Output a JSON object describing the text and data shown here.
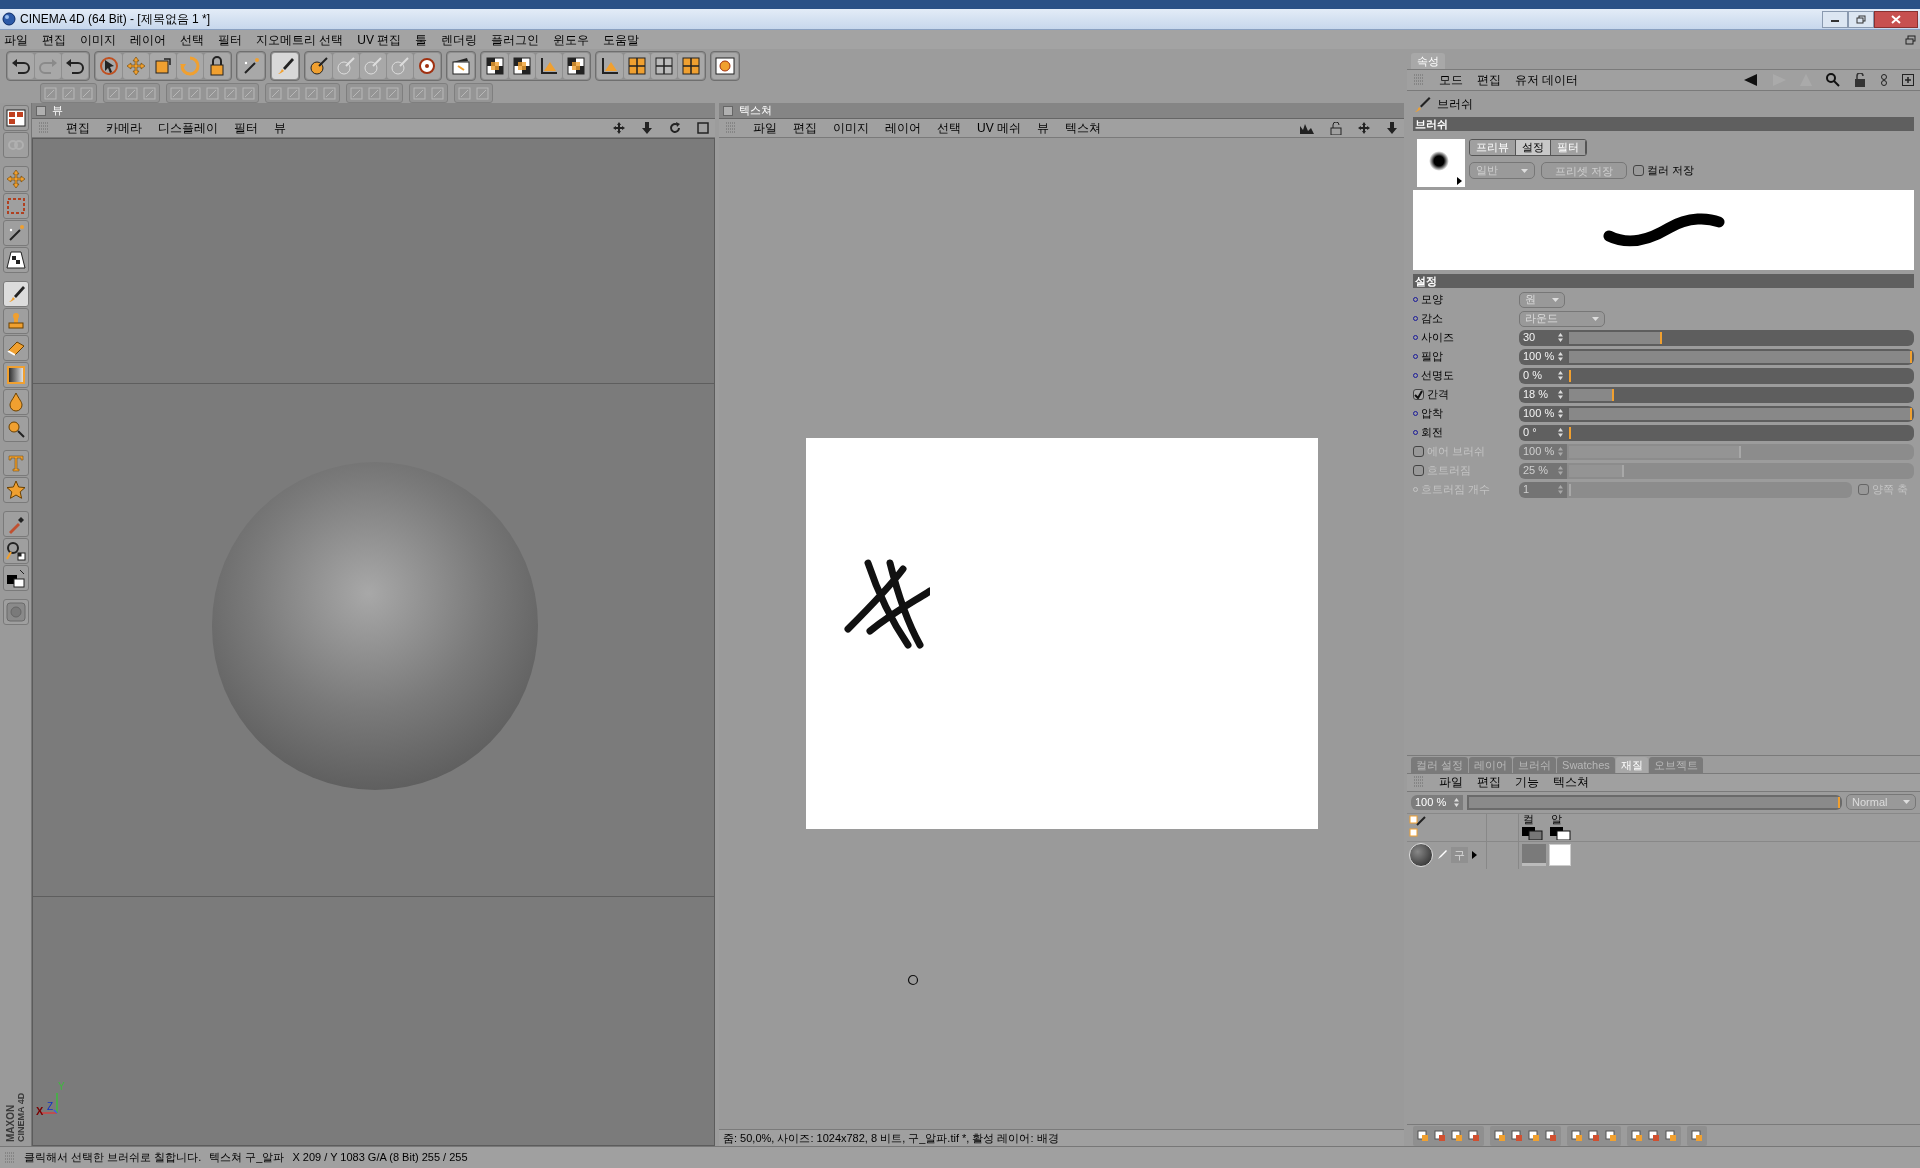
{
  "window": {
    "title": "CINEMA 4D (64 Bit) - [제목없음 1 *]"
  },
  "menu": [
    "파일",
    "편집",
    "이미지",
    "레이어",
    "선택",
    "필터",
    "지오메트리 선택",
    "UV 편집",
    "툴",
    "렌더링",
    "플러그인",
    "윈도우",
    "도움말"
  ],
  "tool_palette": [
    {
      "selected": false
    },
    {
      "selected": false
    },
    {
      "selected": false
    },
    {
      "selected": false
    },
    {
      "selected": false
    },
    {
      "selected": false
    },
    {
      "selected": true
    },
    {
      "selected": false
    },
    {
      "selected": false
    },
    {
      "selected": false
    },
    {
      "selected": false
    },
    {
      "selected": false
    },
    {
      "selected": false
    },
    {
      "selected": false
    },
    {
      "selected": false
    },
    {
      "selected": false
    },
    {
      "selected": false
    },
    {
      "selected": false
    }
  ],
  "viewport": {
    "title": "뷰",
    "menu": [
      "편집",
      "카메라",
      "디스플레이",
      "필터",
      "뷰"
    ],
    "axis_labels": [
      "Y",
      "X",
      "Z"
    ]
  },
  "logo": [
    "MAXON",
    "CINEMA 4D"
  ],
  "texture_view": {
    "title": "텍스쳐",
    "menu": [
      "파일",
      "편집",
      "이미지",
      "레이어",
      "선택",
      "UV 메쉬",
      "뷰",
      "텍스쳐"
    ],
    "status": "줌: 50,0%, 사이즈: 1024x782, 8 비트, 구_알파.tif *, 활성 레이어: 배경"
  },
  "attributes": {
    "tab": "속성",
    "menu": [
      "모드",
      "편집",
      "유저 데이터"
    ],
    "object": "브러쉬",
    "section": "브러쉬",
    "preview_tabs": [
      {
        "label": "프리뷰",
        "selected": false
      },
      {
        "label": "설정",
        "selected": true
      },
      {
        "label": "필터",
        "selected": false
      }
    ],
    "preset": "일반",
    "save_preset": "프리셋 저장",
    "color_save": {
      "label": "컬러 저장",
      "checked": false
    },
    "settings_section": "설정",
    "params": [
      {
        "kind": "dropdown",
        "label": "모양",
        "value": "원",
        "disabled": false
      },
      {
        "kind": "dropdown",
        "label": "감소",
        "value": "라운드",
        "disabled": false
      },
      {
        "kind": "slider",
        "label": "사이즈",
        "value": "30",
        "level": 0.27,
        "disabled": false
      },
      {
        "kind": "slider",
        "label": "필압",
        "value": "100 %",
        "level": 1,
        "disabled": false
      },
      {
        "kind": "slider",
        "label": "선명도",
        "value": "0 %",
        "level": 0,
        "disabled": false
      },
      {
        "kind": "toggle_slider",
        "checked": true,
        "label": "간격",
        "value": "18 %",
        "level": 0.13,
        "disabled": false
      },
      {
        "kind": "slider",
        "label": "압착",
        "value": "100 %",
        "level": 1,
        "disabled": false
      },
      {
        "kind": "slider",
        "label": "회전",
        "value": "0 °",
        "level": 0,
        "disabled": false
      },
      {
        "kind": "toggle_slider",
        "checked": false,
        "label": "에어 브러쉬",
        "value": "100 %",
        "level": 0.5,
        "disabled": true
      },
      {
        "kind": "toggle_slider",
        "checked": false,
        "label": "흐트러짐",
        "value": "25 %",
        "level": 0.16,
        "disabled": true
      },
      {
        "kind": "slider",
        "label": "흐트러짐 개수",
        "value": "1",
        "level": 0,
        "disabled": true,
        "option": {
          "label": "양쪽 축",
          "checked": false
        }
      }
    ]
  },
  "material_panel": {
    "tabs": [
      {
        "label": "컬러 설정",
        "selected": false
      },
      {
        "label": "레이어",
        "selected": false
      },
      {
        "label": "브러쉬",
        "selected": false
      },
      {
        "label": "Swatches",
        "selected": false
      },
      {
        "label": "재질",
        "selected": true
      },
      {
        "label": "오브젝트",
        "selected": false
      }
    ],
    "menu": [
      "파일",
      "편집",
      "기능",
      "텍스쳐"
    ],
    "opacity": {
      "value": "100 %",
      "level": 1
    },
    "blend_mode": "Normal",
    "channel_headers": [
      "컬",
      "알"
    ],
    "layers": [
      {
        "name": "구"
      }
    ]
  },
  "status_bar": {
    "message": "클릭해서 선택한 브러쉬로 칠합니다.",
    "texture": "텍스쳐 구_알파",
    "readout": "X 209 / Y 1083 G/A (8 Bit) 255 / 255"
  }
}
